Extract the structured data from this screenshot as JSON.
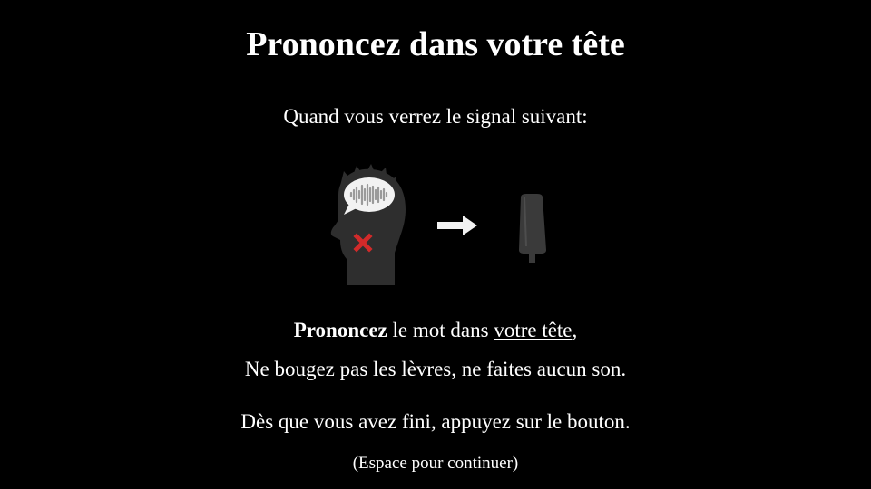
{
  "title": "Prononcez dans votre tête",
  "subtitle": "Quand vous verrez le signal suivant:",
  "illustration": {
    "head_icon": "head-with-speech-bubble-icon",
    "no_lips_mark": "red-x-icon",
    "arrow_icon": "arrow-right-icon",
    "button_icon": "push-button-icon",
    "colors": {
      "head": "#2e2e2e",
      "bubble": "#f2f2f2",
      "waveform": "#9a9a9a",
      "cross": "#d12a2a",
      "arrow": "#f2f2f2",
      "button": "#3a3a3a"
    }
  },
  "instructions": {
    "line1": {
      "bold": "Prononcez",
      "middle": " le mot dans ",
      "underlined": "votre tête",
      "end": ","
    },
    "line2": "Ne bougez pas les lèvres, ne faites aucun son.",
    "line3": "Dès que vous avez fini, appuyez sur le bouton."
  },
  "hint": "(Espace pour continuer)"
}
